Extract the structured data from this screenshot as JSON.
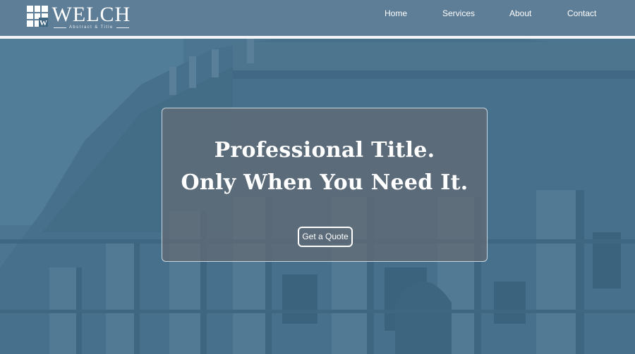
{
  "brand": {
    "name": "WELCH",
    "tagline": "Abstract & Title",
    "logo_mark_letter": "W",
    "colors": {
      "header": "#5e7d96",
      "header_border": "#f2f4f6",
      "hero_tint": "#4c7691",
      "card": "#626a74"
    }
  },
  "nav": {
    "items": [
      {
        "label": "Home"
      },
      {
        "label": "Services"
      },
      {
        "label": "About"
      },
      {
        "label": "Contact"
      }
    ]
  },
  "hero": {
    "headline_line1": "Professional Title.",
    "headline_line2": "Only When You Need It.",
    "cta_label": "Get a Quote"
  }
}
